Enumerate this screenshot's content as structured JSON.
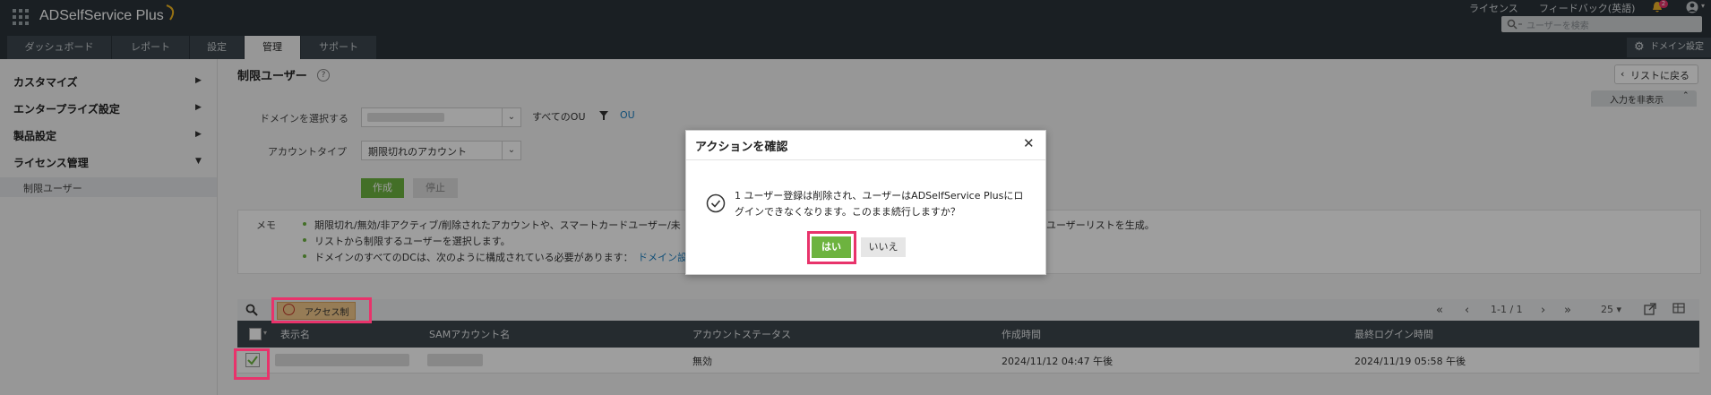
{
  "header": {
    "app_title": "ADSelfService Plus",
    "license_link": "ライセンス",
    "feedback_link": "フィードバック(英語)",
    "notification_count": "2",
    "search_placeholder": "ユーザーを検索"
  },
  "tabs": [
    {
      "label": "ダッシュボード"
    },
    {
      "label": "レポート"
    },
    {
      "label": "設定"
    },
    {
      "label": "管理"
    },
    {
      "label": "サポート"
    }
  ],
  "domain_settings_label": "ドメイン設定",
  "sidebar": {
    "items": [
      {
        "label": "カスタマイズ"
      },
      {
        "label": "エンタープライズ設定"
      },
      {
        "label": "製品設定"
      },
      {
        "label": "ライセンス管理"
      }
    ],
    "sub_item": "制限ユーザー"
  },
  "page": {
    "title": "制限ユーザー",
    "back_button": "リストに戻る",
    "hide_input": "入力を非表示",
    "domain_label": "ドメインを選択する",
    "all_ou": "すべてのOU",
    "ou_link": "OU",
    "account_type_label": "アカウントタイプ",
    "account_type_value": "期限切れのアカウント",
    "create_button": "作成",
    "stop_button": "停止",
    "memo_label": "メモ",
    "memo_lines": [
      "期限切れ/無効/非アクティブ/削除されたアカウントや、スマートカードユーザー/未",
      "リストから制限するユーザーを選択します。",
      "ドメインのすべてのDCは、次のように構成されている必要があります："
    ],
    "memo_line1_tail": "ユーザーリストを生成。",
    "memo_line3_link": "ドメイン設"
  },
  "table": {
    "access_restrict_button": "アクセス制限",
    "pagination": "1-1 / 1",
    "page_size": "25",
    "columns": [
      "表示名",
      "SAMアカウント名",
      "アカウントステータス",
      "作成時間",
      "最終ログイン時間"
    ],
    "row": {
      "status": "無効",
      "created": "2024/11/12 04:47 午後",
      "last_login": "2024/11/19 05:58 午後"
    }
  },
  "modal": {
    "title": "アクションを確認",
    "message": "1 ユーザー登録は削除され、ユーザーはADSelfService Plusにログインできなくなります。このまま続行しますか？",
    "yes": "はい",
    "no": "いいえ"
  },
  "colors": {
    "header_bg": "#2b3339",
    "accent_green": "#6db33f",
    "highlight": "#e8336b"
  }
}
